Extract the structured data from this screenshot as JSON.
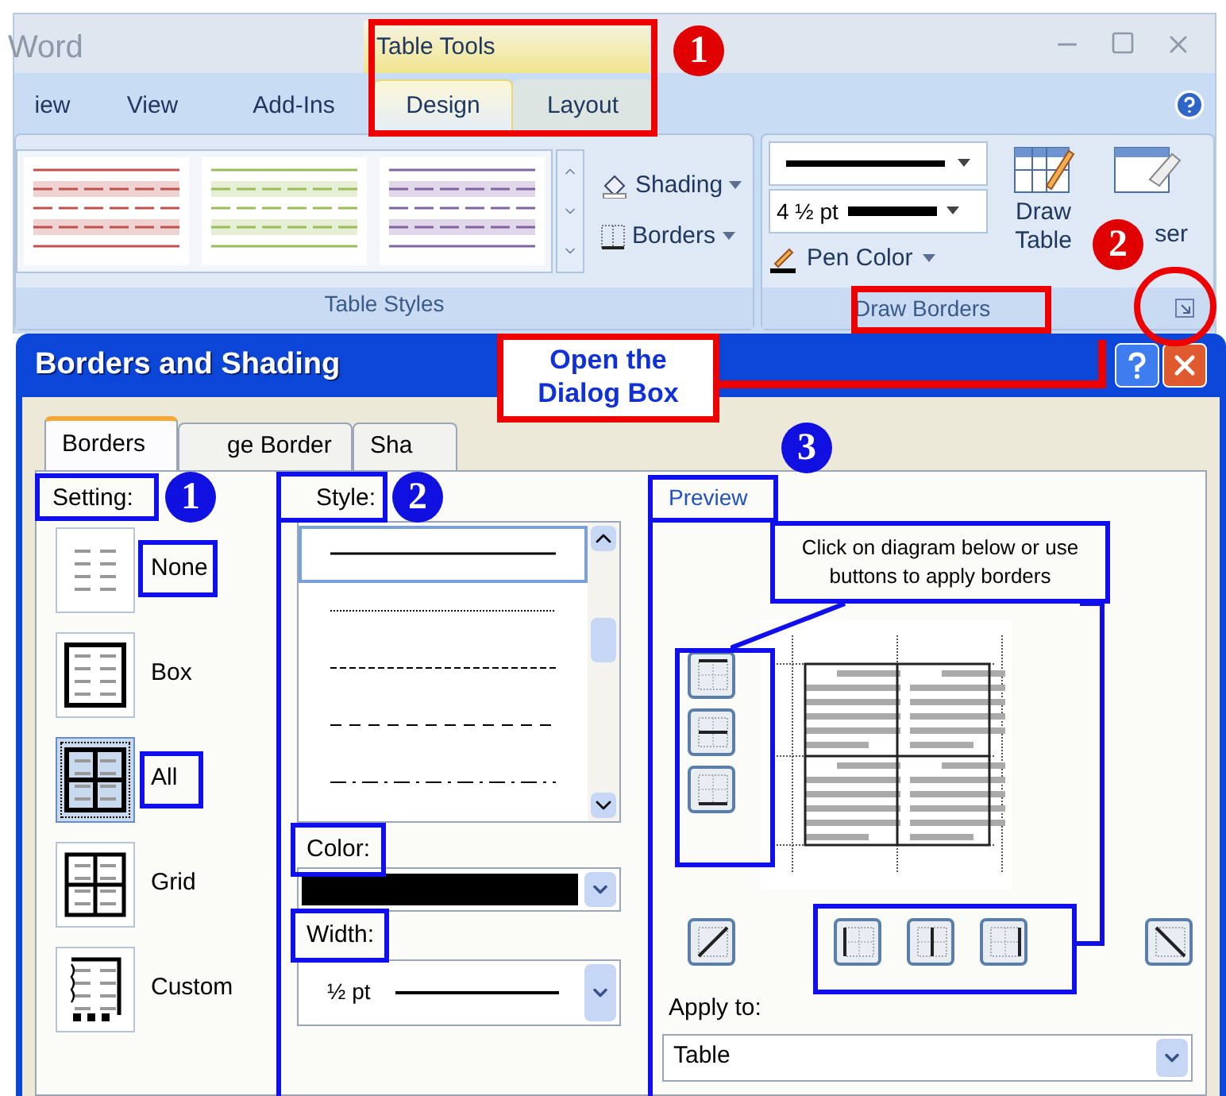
{
  "app_title": "Word",
  "contextual_group": "Table Tools",
  "ribbon_tabs": [
    {
      "label": "iew",
      "selected": false,
      "contextual": false
    },
    {
      "label": "View",
      "selected": false,
      "contextual": false
    },
    {
      "label": "Add-Ins",
      "selected": false,
      "contextual": false
    },
    {
      "label": "Design",
      "selected": true,
      "contextual": true
    },
    {
      "label": "Layout",
      "selected": false,
      "contextual": true
    }
  ],
  "table_styles": {
    "label": "Table Styles",
    "thumbnails": [
      {
        "color": "#c0504d"
      },
      {
        "color": "#9bbb59"
      },
      {
        "color": "#8064a2"
      }
    ],
    "shading": "Shading",
    "borders": "Borders"
  },
  "draw_borders": {
    "label": "Draw Borders",
    "pen_weight": "4 ½ pt",
    "pen_color": "Pen Color",
    "draw_table": "Draw Table",
    "eraser": "ser"
  },
  "dialog": {
    "title": "Borders and Shading",
    "tabs": [
      {
        "label": "Borders",
        "selected": true
      },
      {
        "label": "ge Border",
        "selected": false
      },
      {
        "label": "Sha",
        "selected": false
      }
    ],
    "setting": {
      "label": "Setting:",
      "options": [
        {
          "label": "None",
          "kind": "none",
          "selected": false
        },
        {
          "label": "Box",
          "kind": "box",
          "selected": false
        },
        {
          "label": "All",
          "kind": "all",
          "selected": true
        },
        {
          "label": "Grid",
          "kind": "grid",
          "selected": false
        },
        {
          "label": "Custom",
          "kind": "custom",
          "selected": false
        }
      ]
    },
    "style": {
      "label": "Style:",
      "lines": [
        {
          "kind": "solid",
          "selected": true
        },
        {
          "kind": "dotted",
          "selected": false
        },
        {
          "kind": "fine-dashed",
          "selected": false
        },
        {
          "kind": "dashed",
          "selected": false
        },
        {
          "kind": "dash-dot",
          "selected": false
        }
      ]
    },
    "color": {
      "label": "Color:"
    },
    "width": {
      "label": "Width:",
      "value": "½ pt"
    },
    "preview": {
      "label": "Preview",
      "hint": "Click on diagram below or use buttons to apply borders",
      "apply_to_label": "Apply to:",
      "apply_to": "Table"
    }
  },
  "annotations": {
    "callout": "Open the Dialog Box",
    "red_badges": [
      "1",
      "2"
    ],
    "blue_badges": [
      "1",
      "2",
      "3"
    ]
  }
}
